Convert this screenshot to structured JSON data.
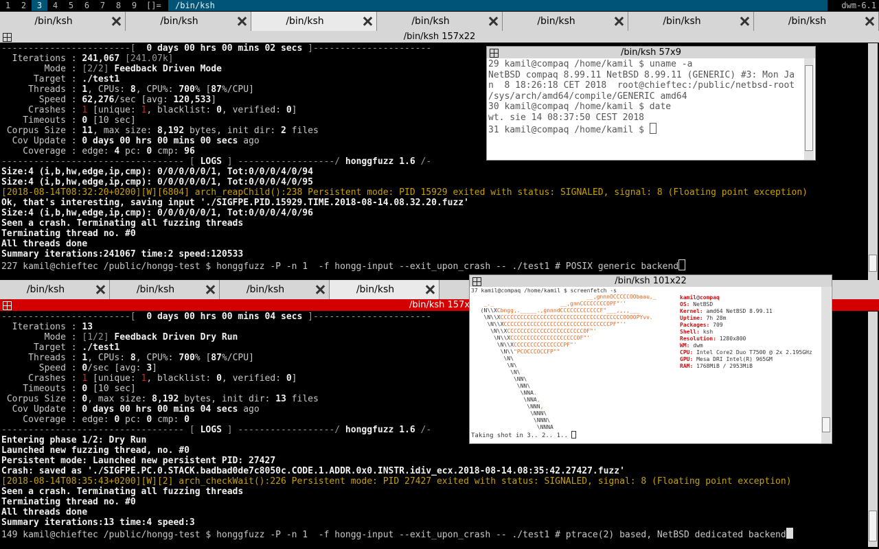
{
  "bar": {
    "tags": [
      "1",
      "2",
      "3",
      "4",
      "5",
      "6",
      "7",
      "8",
      "9"
    ],
    "selected_tag": "3",
    "layout": "[]=",
    "title": "/bin/ksh",
    "status": "dwm-6.1"
  },
  "top_tabs": [
    "/bin/ksh",
    "/bin/ksh",
    "/bin/ksh",
    "/bin/ksh",
    "/bin/ksh",
    "/bin/ksh",
    "/bin/ksh"
  ],
  "top_title": "/bin/ksh 157x22",
  "top_lines": [
    [
      [
        "d",
        "------------------------[  "
      ],
      [
        "b",
        "0 days 00 hrs 00 mins 02 secs"
      ],
      [
        "d",
        " ]----------------------"
      ]
    ],
    [
      [
        "n",
        "  Iterations : "
      ],
      [
        "b",
        "241,067"
      ],
      [
        "d",
        " [241.07k]"
      ]
    ],
    [
      [
        "n",
        "        Mode : "
      ],
      [
        "d",
        "[2/2] "
      ],
      [
        "b",
        "Feedback Driven Mode"
      ]
    ],
    [
      [
        "n",
        "      Target : "
      ],
      [
        "b",
        "./test1"
      ]
    ],
    [
      [
        "n",
        "     Threads : "
      ],
      [
        "b",
        "1"
      ],
      [
        "n",
        ", CPUs: "
      ],
      [
        "b",
        "8"
      ],
      [
        "n",
        ", CPU%: "
      ],
      [
        "b",
        "700"
      ],
      [
        "n",
        "% ["
      ],
      [
        "b",
        "87"
      ],
      [
        "n",
        "%/CPU]"
      ]
    ],
    [
      [
        "n",
        "       Speed : "
      ],
      [
        "b",
        "62,276"
      ],
      [
        "n",
        "/sec [avg: "
      ],
      [
        "b",
        "120,533"
      ],
      [
        "n",
        "]"
      ]
    ],
    [
      [
        "n",
        "     Crashes : "
      ],
      [
        "r",
        "1"
      ],
      [
        "n",
        " [unique: "
      ],
      [
        "r",
        "1"
      ],
      [
        "n",
        ", blacklist: "
      ],
      [
        "b",
        "0"
      ],
      [
        "n",
        ", verified: "
      ],
      [
        "b",
        "0"
      ],
      [
        "n",
        "]"
      ]
    ],
    [
      [
        "n",
        "    Timeouts : "
      ],
      [
        "b",
        "0"
      ],
      [
        "n",
        " [10 sec]"
      ]
    ],
    [
      [
        "n",
        " Corpus Size : "
      ],
      [
        "b",
        "11"
      ],
      [
        "n",
        ", max size: "
      ],
      [
        "b",
        "8,192"
      ],
      [
        "n",
        " bytes, init dir: "
      ],
      [
        "b",
        "2"
      ],
      [
        "n",
        " files"
      ]
    ],
    [
      [
        "n",
        "  Cov Update : "
      ],
      [
        "b",
        "0 days 00 hrs 00 mins 00 secs"
      ],
      [
        "n",
        " ago"
      ]
    ],
    [
      [
        "n",
        "    Coverage : edge: "
      ],
      [
        "b",
        "4"
      ],
      [
        "n",
        " pc: "
      ],
      [
        "b",
        "0"
      ],
      [
        "n",
        " cmp: "
      ],
      [
        "b",
        "96"
      ]
    ],
    [
      [
        "d",
        "---------------------------------- [ "
      ],
      [
        "b",
        "LOGS"
      ],
      [
        "d",
        " ] ------------------/ "
      ],
      [
        "b",
        "honggfuzz 1.6"
      ],
      [
        "d",
        " /-"
      ]
    ],
    [
      [
        "b",
        "Size:4 (i,b,hw,edge,ip,cmp): 0/0/0/0/0/1, Tot:0/0/0/4/0/94"
      ]
    ],
    [
      [
        "b",
        "Size:4 (i,b,hw,edge,ip,cmp): 0/0/0/0/0/1, Tot:0/0/0/4/0/95"
      ]
    ],
    [
      [
        "y",
        "[2018-08-14T08:32:20+0200][W][6804] arch_reapChild():238 Persistent mode: PID 15929 exited with status: SIGNALED, signal: 8 (Floating point exception)"
      ]
    ],
    [
      [
        "b",
        "Ok, that's interesting, saving input './SIGFPE.PID.15929.TIME.2018-08-14.08.32.20.fuzz'"
      ]
    ],
    [
      [
        "b",
        "Size:4 (i,b,hw,edge,ip,cmp): 0/0/0/0/0/1, Tot:0/0/0/4/0/96"
      ]
    ],
    [
      [
        "b",
        "Seen a crash. Terminating all fuzzing threads"
      ]
    ],
    [
      [
        "b",
        "Terminating thread no. #0"
      ]
    ],
    [
      [
        "b",
        "All threads done"
      ]
    ],
    [
      [
        "b",
        "Summary iterations:241067 time:2 speed:120533"
      ]
    ],
    [
      [
        "n",
        "227 kamil@chieftec /public/hongg-test $ honggfuzz -P -n 1  -f hongg-input --exit_upon_crash -- ./test1 # POSIX generic backend"
      ]
    ]
  ],
  "float1": {
    "title": "/bin/ksh 57x9",
    "lines": [
      "29 kamil@compaq /home/kamil $ uname -a",
      "NetBSD compaq 8.99.11 NetBSD 8.99.11 (GENERIC) #3: Mon Ja",
      "n  8 18:26:18 CET 2018  root@chieftec:/public/netbsd-root",
      "/sys/arch/amd64/compile/GENERIC amd64",
      "30 kamil@compaq /home/kamil $ date",
      "wt. sie 14 08:37:50 CEST 2018",
      "31 kamil@compaq /home/kamil $ "
    ]
  },
  "bottom_tabs": [
    "/bin/ksh",
    "/bin/ksh",
    "/bin/ksh",
    "/bin/ksh"
  ],
  "bottom_title": "/bin/ksh 157x",
  "bottom_lines": [
    [
      [
        "d",
        "------------------------[  "
      ],
      [
        "b",
        "0 days 00 hrs 00 mins 04 secs"
      ],
      [
        "d",
        " ]----------------------"
      ]
    ],
    [
      [
        "n",
        "  Iterations : "
      ],
      [
        "b",
        "13"
      ]
    ],
    [
      [
        "n",
        "        Mode : "
      ],
      [
        "d",
        "[1/2] "
      ],
      [
        "b",
        "Feedback Driven Dry Run"
      ]
    ],
    [
      [
        "n",
        "      Target : "
      ],
      [
        "b",
        "./test1"
      ]
    ],
    [
      [
        "n",
        "     Threads : "
      ],
      [
        "b",
        "1"
      ],
      [
        "n",
        ", CPUs: "
      ],
      [
        "b",
        "8"
      ],
      [
        "n",
        ", CPU%: "
      ],
      [
        "b",
        "700"
      ],
      [
        "n",
        "% ["
      ],
      [
        "b",
        "87"
      ],
      [
        "n",
        "%/CPU]"
      ]
    ],
    [
      [
        "n",
        "       Speed : "
      ],
      [
        "b",
        "0"
      ],
      [
        "n",
        "/sec [avg: "
      ],
      [
        "b",
        "3"
      ],
      [
        "n",
        "]"
      ]
    ],
    [
      [
        "n",
        "     Crashes : "
      ],
      [
        "r",
        "1"
      ],
      [
        "n",
        " [unique: "
      ],
      [
        "r",
        "1"
      ],
      [
        "n",
        ", blacklist: "
      ],
      [
        "b",
        "0"
      ],
      [
        "n",
        ", verified: "
      ],
      [
        "b",
        "0"
      ],
      [
        "n",
        "]"
      ]
    ],
    [
      [
        "n",
        "    Timeouts : "
      ],
      [
        "b",
        "0"
      ],
      [
        "n",
        " [10 sec]"
      ]
    ],
    [
      [
        "n",
        " Corpus Size : "
      ],
      [
        "b",
        "0"
      ],
      [
        "n",
        ", max size: "
      ],
      [
        "b",
        "8,192"
      ],
      [
        "n",
        " bytes, init dir: "
      ],
      [
        "b",
        "13"
      ],
      [
        "n",
        " files"
      ]
    ],
    [
      [
        "n",
        "  Cov Update : "
      ],
      [
        "b",
        "0 days 00 hrs 00 mins 04 secs"
      ],
      [
        "n",
        " ago"
      ]
    ],
    [
      [
        "n",
        "    Coverage : edge: "
      ],
      [
        "b",
        "0"
      ],
      [
        "n",
        " pc: "
      ],
      [
        "b",
        "0"
      ],
      [
        "n",
        " cmp: "
      ],
      [
        "b",
        "0"
      ]
    ],
    [
      [
        "d",
        "---------------------------------- [ "
      ],
      [
        "b",
        "LOGS"
      ],
      [
        "d",
        " ] ------------------/ "
      ],
      [
        "b",
        "honggfuzz 1.6"
      ],
      [
        "d",
        " /-"
      ]
    ],
    [
      [
        "b",
        "Entering phase 1/2: Dry Run"
      ]
    ],
    [
      [
        "b",
        "Launched new fuzzing thread, no. #0"
      ]
    ],
    [
      [
        "b",
        "Persistent mode: Launched new persistent PID: 27427"
      ]
    ],
    [
      [
        "b",
        "Crash: saved as './SIGFPE.PC.0.STACK.badbad0de7c8050c.CODE.1.ADDR.0x0.INSTR.idiv_ecx.2018-08-14.08:35:42.27427.fuzz'"
      ]
    ],
    [
      [
        "y",
        "[2018-08-14T08:35:43+0200][W][2] arch_checkWait():226 Persistent mode: PID 27427 exited with status: SIGNALED, signal: 8 (Floating point exception)"
      ]
    ],
    [
      [
        "b",
        "Seen a crash. Terminating all fuzzing threads"
      ]
    ],
    [
      [
        "b",
        "Terminating thread no. #0"
      ]
    ],
    [
      [
        "b",
        "All threads done"
      ]
    ],
    [
      [
        "b",
        "Summary iterations:13 time:4 speed:3"
      ]
    ],
    [
      [
        "n",
        "149 kamil@chieftec /public/hongg-test $ honggfuzz -P -n 1  -f hongg-input --exit_upon_crash -- ./test1 # ptrace(2) based, NetBSD dedicated backend"
      ]
    ]
  ],
  "float2": {
    "title": "/bin/ksh 101x22",
    "prompt": "37 kamil@compaq /home/kamil $ screenfetch -s",
    "logo": [
      "                                  __,gnnnOCCCCCOObaau,_",
      "   _._                    __,gnnCCCCCCCCOPF\"''",
      "  (N\\\\XCbngg,._____.,gnnndCCCCCCCCCCCCF\"___,,,,___",
      "   \\N\\\\XCCCCCCCCCCCCCCCCCCCCCCCCCCCCCCCCCCCCCOOOOPYvv.",
      "    \\N\\\\XCCCCCCCCCCCCCCCCCCCCCCCCCCCCCCCCPF\"''",
      "     \\N\\\\XCCCCCCCCCCCCCCCCCCCCCCCOF\"'",
      "      \\N\\\\XCCCCCCCCCCCCCCCCCCCCOF\"'",
      "       \\N\\\\XCCCCCCCCCCCCCCCPF\"'",
      "        \\N\\\\\"PCOCCCOCCFP\"\"",
      "         \\N\\",
      "          \\N\\",
      "           \\N\\",
      "            \\NN\\",
      "             \\NN\\",
      "              \\NNA.",
      "               \\NNA,",
      "                \\NNN,",
      "                 \\NNN\\",
      "                  \\NNN\\",
      "                   \\NNNA"
    ],
    "info_user": "kamil",
    "info_host": "compaq",
    "info": [
      [
        "OS:",
        "NetBSD"
      ],
      [
        "Kernel:",
        "amd64 NetBSD 8.99.11"
      ],
      [
        "Uptime:",
        "7h 28m"
      ],
      [
        "Packages:",
        "709"
      ],
      [
        "Shell:",
        "ksh"
      ],
      [
        "Resolution:",
        "1280x800"
      ],
      [
        "WM:",
        "dwm"
      ],
      [
        "CPU:",
        "Intel Core2 Duo T7500 @ 2x 2.195GHz"
      ],
      [
        "GPU:",
        "Mesa DRI Intel(R) 965GM"
      ],
      [
        "RAM:",
        "1768MiB / 2953MiB"
      ]
    ],
    "footer": "Taking shot in 3.. 2.. 1.. "
  },
  "colors": {
    "bar_selected": "#005577",
    "focused_title": "#d40000",
    "logo_orange": "#e8621a",
    "info_red": "#cc1010",
    "warning": "#c8a000"
  }
}
